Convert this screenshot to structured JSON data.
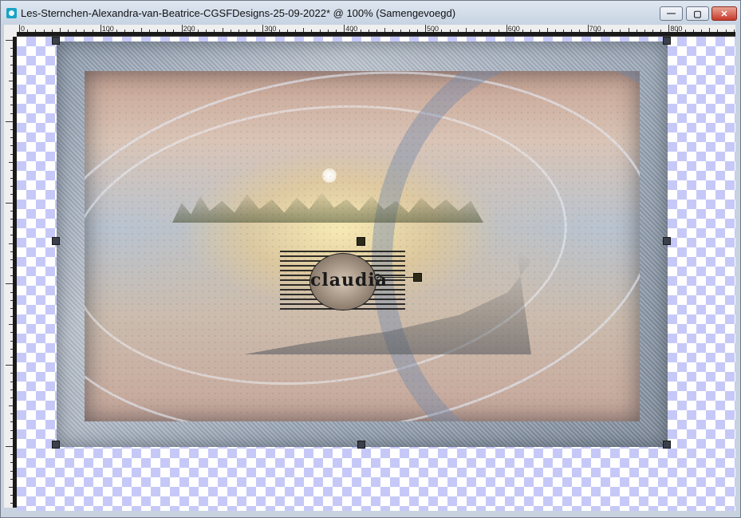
{
  "window": {
    "title": "Les-Sternchen-Alexandra-van-Beatrice-CGSFDesigns-25-09-2022* @ 100% (Samengevoegd)",
    "buttons": {
      "minimize": "—",
      "maximize": "▢",
      "close": "✕"
    }
  },
  "ruler": {
    "labels": [
      "0",
      "100",
      "200",
      "300",
      "400",
      "500",
      "600",
      "700",
      "800"
    ]
  },
  "image": {
    "logo_text": "claudia"
  },
  "colors": {
    "checker": "#c6c9f7",
    "titlebar": "#d7e0eb",
    "close_button": "#c7392a"
  }
}
